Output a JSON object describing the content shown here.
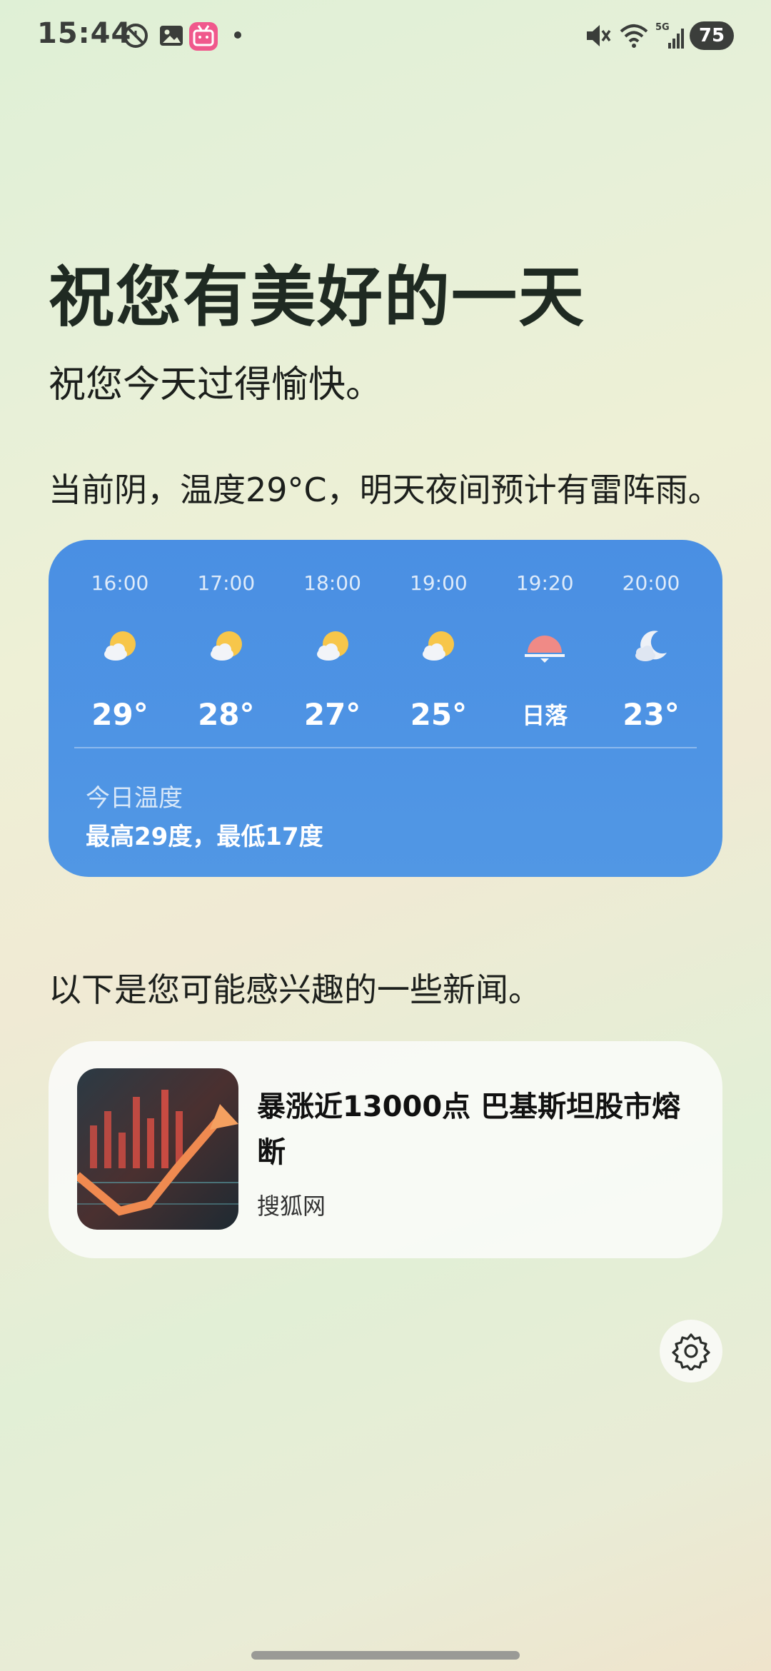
{
  "status_bar": {
    "time": "15:44",
    "battery": "75",
    "icons": [
      "no-alarm-icon",
      "gallery-icon",
      "bilibili-icon",
      "dot-icon",
      "mute-icon",
      "wifi-icon",
      "5g-signal-icon"
    ],
    "network_label": "5G"
  },
  "greeting": {
    "title": "祝您有美好的一天",
    "subtitle": "祝您今天过得愉快。"
  },
  "weather": {
    "summary": "当前阴，温度29°C，明天夜间预计有雷阵雨。",
    "hours": [
      {
        "time": "16:00",
        "icon": "partly-cloudy-icon",
        "temp": "29°"
      },
      {
        "time": "17:00",
        "icon": "partly-cloudy-icon",
        "temp": "28°"
      },
      {
        "time": "18:00",
        "icon": "partly-cloudy-icon",
        "temp": "27°"
      },
      {
        "time": "19:00",
        "icon": "partly-cloudy-icon",
        "temp": "25°"
      },
      {
        "time": "19:20",
        "icon": "sunset-icon",
        "temp": "日落"
      },
      {
        "time": "20:00",
        "icon": "cloudy-night-icon",
        "temp": "23°"
      }
    ],
    "today_label": "今日温度",
    "today_range": "最高29度，最低17度",
    "card_color": "#4a8fe3"
  },
  "news": {
    "intro": "以下是您可能感兴趣的一些新闻。",
    "items": [
      {
        "title": "暴涨近13000点 巴基斯坦股市熔断",
        "source": "搜狐网",
        "thumbnail": "stock-chart-thumbnail"
      }
    ]
  },
  "settings": {
    "icon": "gear-icon"
  }
}
